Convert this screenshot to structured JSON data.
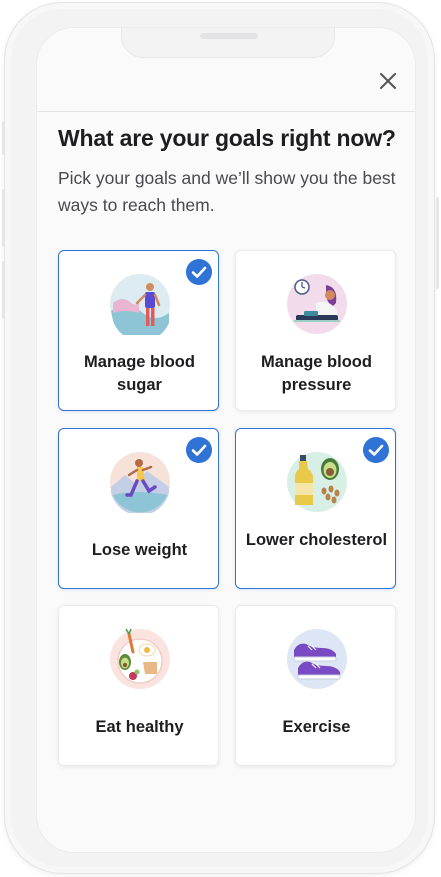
{
  "header": {
    "close_icon": "close-icon"
  },
  "main": {
    "title": "What are your goals right now?",
    "subtitle": "Pick your goals and we’ll show you the best ways to reach them."
  },
  "goals": [
    {
      "label": "Manage blood sugar",
      "selected": true,
      "icon": "blood-sugar-illustration-icon"
    },
    {
      "label": "Manage blood pressure",
      "selected": false,
      "icon": "blood-pressure-illustration-icon"
    },
    {
      "label": "Lose weight",
      "selected": true,
      "icon": "running-woman-illustration-icon"
    },
    {
      "label": "Lower cholesterol",
      "selected": true,
      "icon": "oil-avocado-illustration-icon"
    },
    {
      "label": "Eat healthy",
      "selected": false,
      "icon": "healthy-plate-illustration-icon"
    },
    {
      "label": "Exercise",
      "selected": false,
      "icon": "sneakers-illustration-icon"
    }
  ],
  "colors": {
    "accent": "#2f73d6",
    "text": "#1e1e20",
    "subtext": "#4a4a4e"
  }
}
